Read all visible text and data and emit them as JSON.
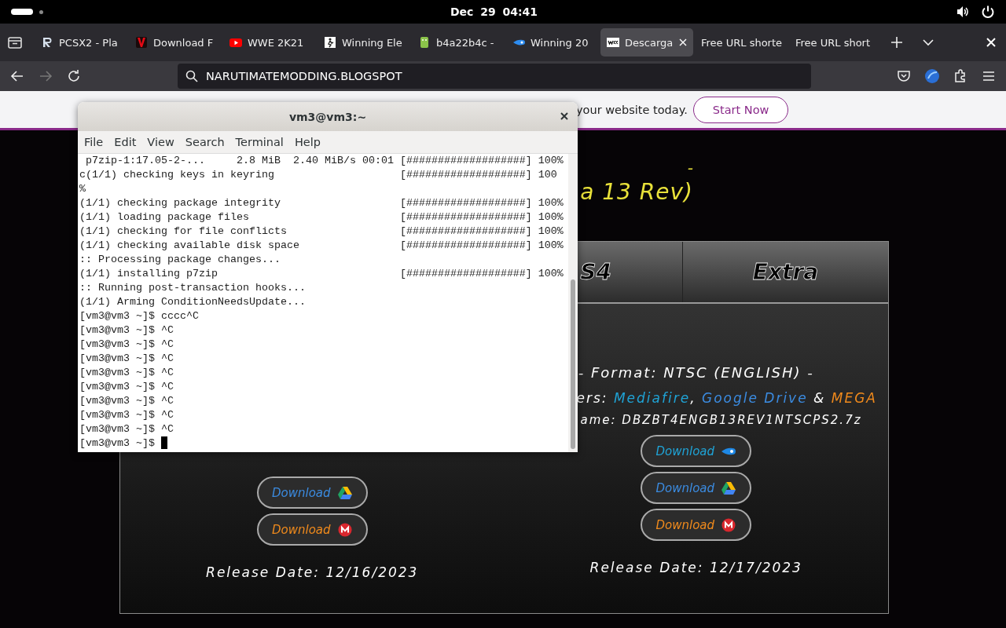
{
  "top_bar": {
    "date": "Dec 29",
    "time": "04:41"
  },
  "browser": {
    "tabs": [
      {
        "title": "PCSX2 - Pla",
        "kind": "r",
        "selected": false
      },
      {
        "title": "Download F",
        "kind": "v",
        "selected": false
      },
      {
        "title": "WWE 2K21",
        "kind": "play",
        "selected": false
      },
      {
        "title": "Winning Ele",
        "kind": "player",
        "selected": false
      },
      {
        "title": "b4a22b4c -",
        "kind": "droid",
        "selected": false
      },
      {
        "title": "Winning 20",
        "kind": "comet",
        "selected": false
      },
      {
        "title": "Descarga",
        "kind": "wix",
        "selected": true
      },
      {
        "title": "Free URL shorte",
        "kind": "plain",
        "selected": false
      },
      {
        "title": "Free URL short",
        "kind": "plain",
        "selected": false
      }
    ],
    "url": "NARUTIMATEMODDING.BLOGSPOT"
  },
  "page": {
    "banner": {
      "text": "your website today.",
      "button": "Start Now"
    },
    "heading": [
      "-",
      "a 13 Rev)"
    ],
    "tabs": [
      "S4",
      "Extra"
    ],
    "left": {
      "buttons": [
        {
          "label": "Download",
          "kind": "drive"
        },
        {
          "label": "Download",
          "kind": "mega"
        }
      ],
      "release_date": "Release Date: 12/16/2023"
    },
    "right": {
      "format": "- Format: NTSC (ENGLISH) -",
      "servers": [
        {
          "text": "ers: ",
          "kind": "plain"
        },
        {
          "text": "Mediafire",
          "kind": "mediafire"
        },
        {
          "text": ", ",
          "kind": "plain"
        },
        {
          "text": "Google Drive",
          "kind": "drive"
        },
        {
          "text": " & ",
          "kind": "plain"
        },
        {
          "text": "MEGA",
          "kind": "mega"
        }
      ],
      "file_name": "ame: DBZBT4ENGB13REV1NTSCPS2.7z",
      "buttons": [
        {
          "label": "Download",
          "kind": "mediafire"
        },
        {
          "label": "Download",
          "kind": "drive"
        },
        {
          "label": "Download",
          "kind": "mega"
        }
      ],
      "release_date": "Release Date: 12/17/2023"
    }
  },
  "terminal": {
    "title": "vm3@vm3:~",
    "menu": [
      "File",
      "Edit",
      "View",
      "Search",
      "Terminal",
      "Help"
    ],
    "lines": [
      {
        "text": " p7zip-1:17.05-2-...     2.8 MiB  2.40 MiB/s 00:01",
        "progress": "[###################] 100%"
      },
      {
        "text": "c(1/1) checking keys in keyring",
        "progress": "[###################] 100"
      },
      {
        "text": "%"
      },
      {
        "text": "(1/1) checking package integrity",
        "progress": "[###################] 100%"
      },
      {
        "text": "(1/1) loading package files",
        "progress": "[###################] 100%"
      },
      {
        "text": "(1/1) checking for file conflicts",
        "progress": "[###################] 100%"
      },
      {
        "text": "(1/1) checking available disk space",
        "progress": "[###################] 100%"
      },
      {
        "text": ":: Processing package changes..."
      },
      {
        "text": "(1/1) installing p7zip",
        "progress": "[###################] 100%"
      },
      {
        "text": ":: Running post-transaction hooks..."
      },
      {
        "text": "(1/1) Arming ConditionNeedsUpdate..."
      },
      {
        "text": "[vm3@vm3 ~]$ cccc^C"
      },
      {
        "text": "[vm3@vm3 ~]$ ^C"
      },
      {
        "text": "[vm3@vm3 ~]$ ^C"
      },
      {
        "text": "[vm3@vm3 ~]$ ^C"
      },
      {
        "text": "[vm3@vm3 ~]$ ^C"
      },
      {
        "text": "[vm3@vm3 ~]$ ^C"
      },
      {
        "text": "[vm3@vm3 ~]$ ^C"
      },
      {
        "text": "[vm3@vm3 ~]$ ^C"
      },
      {
        "text": "[vm3@vm3 ~]$ ^C"
      }
    ],
    "prompt": "[vm3@vm3 ~]$"
  }
}
